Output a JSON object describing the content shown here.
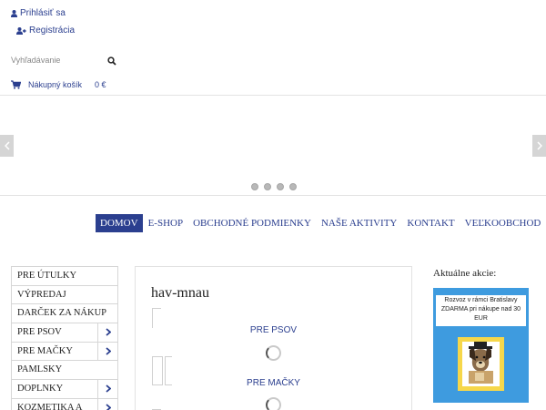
{
  "header": {
    "login_label": "Prihlásiť sa",
    "register_label": "Registrácia",
    "search": {
      "placeholder": "Vyhľadávanie",
      "value": ""
    },
    "cart": {
      "label": "Nákupný košík",
      "total": "0 €"
    }
  },
  "slider": {
    "dot_count": 4
  },
  "nav": {
    "items": [
      {
        "label": "DOMOV",
        "active": true
      },
      {
        "label": "E-SHOP"
      },
      {
        "label": "OBCHODNÉ PODMIENKY"
      },
      {
        "label": "NAŠE AKTIVITY"
      },
      {
        "label": "KONTAKT"
      },
      {
        "label": "VEĽKOOBCHOD"
      }
    ]
  },
  "sidebar": {
    "items": [
      {
        "label": "PRE ÚTULKY",
        "has_submenu": false
      },
      {
        "label": "VÝPREDAJ",
        "has_submenu": false
      },
      {
        "label": "DARČEK ZA NÁKUP",
        "has_submenu": false
      },
      {
        "label": "PRE PSOV",
        "has_submenu": true
      },
      {
        "label": "PRE MAČKY",
        "has_submenu": true
      },
      {
        "label": "PAMLSKY",
        "has_submenu": false
      },
      {
        "label": "DOPLNKY",
        "has_submenu": true
      },
      {
        "label": "KOZMETIKA A",
        "has_submenu": true
      }
    ]
  },
  "main": {
    "title": "hav-mnau",
    "categories": [
      {
        "label": "PRE PSOV"
      },
      {
        "label": "PRE MAČKY"
      }
    ]
  },
  "promo": {
    "heading": "Aktuálne akcie:",
    "text": "Rozvoz v rámci Bratislavy ZDARMA pri nákupe nad 30 EUR"
  },
  "colors": {
    "accent": "#2b3f8f",
    "promo_bg": "#3e9bdf",
    "frame": "#f6d74a",
    "chevron": "#2b3f8f"
  },
  "icons": {
    "login": "user-icon",
    "register": "user-plus-icon",
    "search": "search-icon",
    "cart": "cart-icon",
    "submenu": "chevron-right-icon"
  }
}
